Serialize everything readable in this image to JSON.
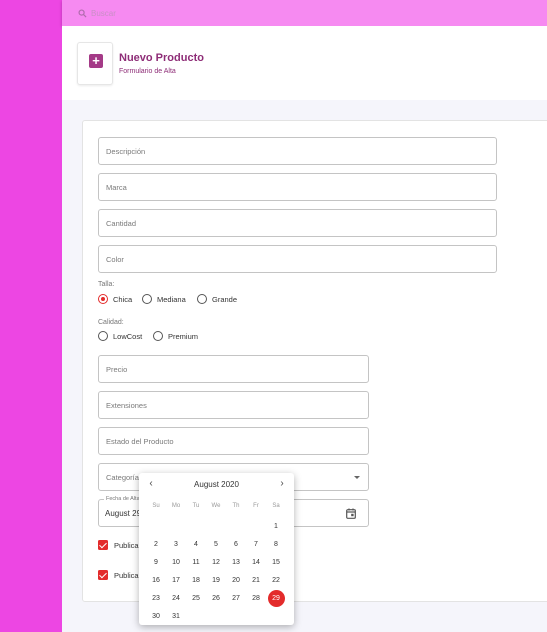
{
  "search": {
    "placeholder": "Buscar"
  },
  "header": {
    "title": "Nuevo Producto",
    "subtitle": "Formulario de Alta"
  },
  "form": {
    "descripcion": "Descripción",
    "marca": "Marca",
    "cantidad": "Cantidad",
    "color": "Color",
    "talla": {
      "label": "Talla:",
      "options": [
        "Chica",
        "Mediana",
        "Grande"
      ],
      "selected": "Chica"
    },
    "calidad": {
      "label": "Calidad:",
      "options": [
        "LowCost",
        "Premium"
      ],
      "selected": ""
    },
    "precio": "Precio",
    "extensiones": "Extensiones",
    "estado": "Estado del Producto",
    "categoria": "Categoría",
    "fecha": {
      "label": "Fecha de Alta",
      "value": "August 29, 2020"
    },
    "publicar1": "Publicar",
    "publicar2": "Publicar"
  },
  "calendar": {
    "month": "August 2020",
    "weekdays": [
      "Su",
      "Mo",
      "Tu",
      "We",
      "Th",
      "Fr",
      "Sa"
    ],
    "first_weekday_index": 6,
    "days": [
      "1",
      "2",
      "3",
      "4",
      "5",
      "6",
      "7",
      "8",
      "9",
      "10",
      "11",
      "12",
      "13",
      "14",
      "15",
      "16",
      "17",
      "18",
      "19",
      "20",
      "21",
      "22",
      "23",
      "24",
      "25",
      "26",
      "27",
      "28",
      "29",
      "30",
      "31"
    ],
    "selected_day": "29"
  },
  "colors": {
    "sidebar": "#ed46e3",
    "topbar": "#f68af1",
    "accent": "#e32b2b",
    "title": "#8e2d77"
  }
}
